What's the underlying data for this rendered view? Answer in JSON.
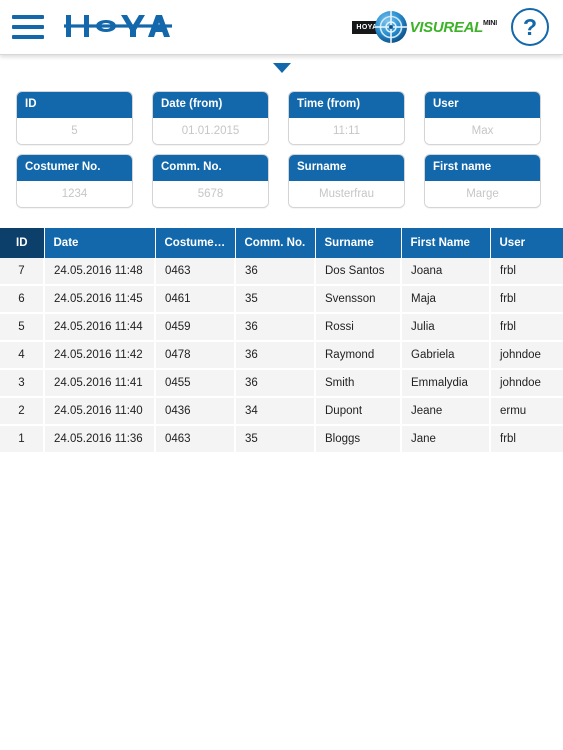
{
  "header": {
    "menu_icon": "hamburger-menu-icon",
    "brand": "HOYA",
    "product_tag": "HOYA",
    "product_name": "VISUREAL",
    "product_variant": "MINI",
    "help_label": "?",
    "brand_color": "#1268ab",
    "product_color": "#3cb329"
  },
  "collapse_toggle": {
    "icon": "chevron-down-icon"
  },
  "search": {
    "rows": [
      [
        {
          "label": "ID",
          "value": "",
          "placeholder": "5"
        },
        {
          "label": "Date (from)",
          "value": "",
          "placeholder": "01.01.2015"
        },
        {
          "label": "Time (from)",
          "value": "",
          "placeholder": "11:11"
        },
        {
          "label": "User",
          "value": "",
          "placeholder": "Max"
        }
      ],
      [
        {
          "label": "Costumer No.",
          "value": "",
          "placeholder": "1234"
        },
        {
          "label": "Comm. No.",
          "value": "",
          "placeholder": "5678"
        },
        {
          "label": "Surname",
          "value": "",
          "placeholder": "Musterfrau"
        },
        {
          "label": "First name",
          "value": "",
          "placeholder": "Marge"
        }
      ]
    ]
  },
  "table": {
    "columns": [
      {
        "key": "id",
        "label": "ID",
        "sorted": true
      },
      {
        "key": "date",
        "label": "Date",
        "sorted": false
      },
      {
        "key": "customer_no",
        "label": "Costumer...",
        "sorted": false
      },
      {
        "key": "comm_no",
        "label": "Comm. No.",
        "sorted": false
      },
      {
        "key": "surname",
        "label": "Surname",
        "sorted": false
      },
      {
        "key": "first_name",
        "label": "First Name",
        "sorted": false
      },
      {
        "key": "user",
        "label": "User",
        "sorted": false
      }
    ],
    "rows": [
      {
        "id": "7",
        "date": "24.05.2016 11:48",
        "customer_no": "0463",
        "comm_no": "36",
        "surname": "Dos Santos",
        "first_name": "Joana",
        "user": "frbl"
      },
      {
        "id": "6",
        "date": "24.05.2016 11:45",
        "customer_no": "0461",
        "comm_no": "35",
        "surname": "Svensson",
        "first_name": "Maja",
        "user": "frbl"
      },
      {
        "id": "5",
        "date": "24.05.2016 11:44",
        "customer_no": "0459",
        "comm_no": "36",
        "surname": "Rossi",
        "first_name": "Julia",
        "user": "frbl"
      },
      {
        "id": "4",
        "date": "24.05.2016 11:42",
        "customer_no": "0478",
        "comm_no": "36",
        "surname": "Raymond",
        "first_name": "Gabriela",
        "user": "johndoe"
      },
      {
        "id": "3",
        "date": "24.05.2016 11:41",
        "customer_no": "0455",
        "comm_no": "36",
        "surname": "Smith",
        "first_name": "Emmalydia",
        "user": "johndoe"
      },
      {
        "id": "2",
        "date": "24.05.2016 11:40",
        "customer_no": "0436",
        "comm_no": "34",
        "surname": "Dupont",
        "first_name": "Jeane",
        "user": "ermu"
      },
      {
        "id": "1",
        "date": "24.05.2016 11:36",
        "customer_no": "0463",
        "comm_no": "35",
        "surname": "Bloggs",
        "first_name": "Jane",
        "user": "frbl"
      }
    ]
  }
}
